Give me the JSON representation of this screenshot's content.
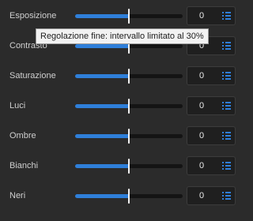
{
  "tooltip": {
    "text": "Regolazione fine: intervallo limitato al 30%"
  },
  "accent_color": "#2f7fd9",
  "sliders": [
    {
      "label": "Esposizione",
      "value": "0",
      "level": 0.5,
      "icon": "fine-adjust-icon"
    },
    {
      "label": "Contrasto",
      "value": "0",
      "level": 0.5,
      "icon": "fine-adjust-icon"
    },
    {
      "label": "Saturazione",
      "value": "0",
      "level": 0.5,
      "icon": "fine-adjust-icon"
    },
    {
      "label": "Luci",
      "value": "0",
      "level": 0.5,
      "icon": "fine-adjust-icon"
    },
    {
      "label": "Ombre",
      "value": "0",
      "level": 0.5,
      "icon": "fine-adjust-icon"
    },
    {
      "label": "Bianchi",
      "value": "0",
      "level": 0.5,
      "icon": "fine-adjust-icon"
    },
    {
      "label": "Neri",
      "value": "0",
      "level": 0.5,
      "icon": "fine-adjust-icon"
    }
  ]
}
